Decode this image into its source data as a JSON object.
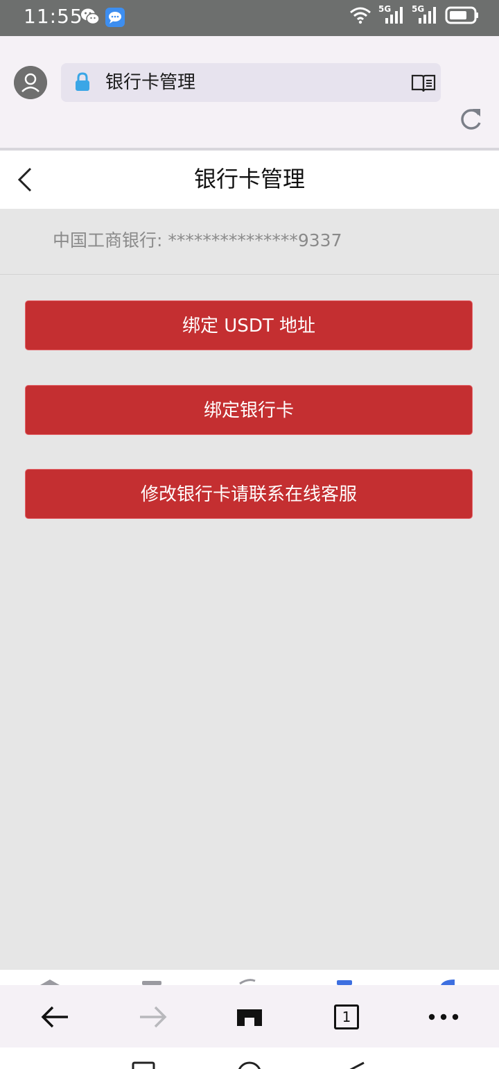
{
  "status_bar": {
    "time": "11:55",
    "network_1": "5G",
    "network_2": "5G",
    "icons": [
      "wechat-icon",
      "message-icon",
      "wifi-icon",
      "signal-icon",
      "signal-icon",
      "battery-icon"
    ]
  },
  "browser": {
    "url_text": "银行卡管理",
    "tab_count": "1"
  },
  "page": {
    "title": "银行卡管理",
    "card_info": "中国工商银行: ***************9337"
  },
  "buttons": {
    "bind_usdt": "绑定 USDT 地址",
    "bind_card": "绑定银行卡",
    "modify_card": "修改银行卡请联系在线客服"
  },
  "colors": {
    "status_bar": "#6d6f6e",
    "chrome": "#f5f1f6",
    "page_bg": "#e6e6e6",
    "button_red": "#c42f31",
    "lock_blue": "#3aa6e6"
  }
}
